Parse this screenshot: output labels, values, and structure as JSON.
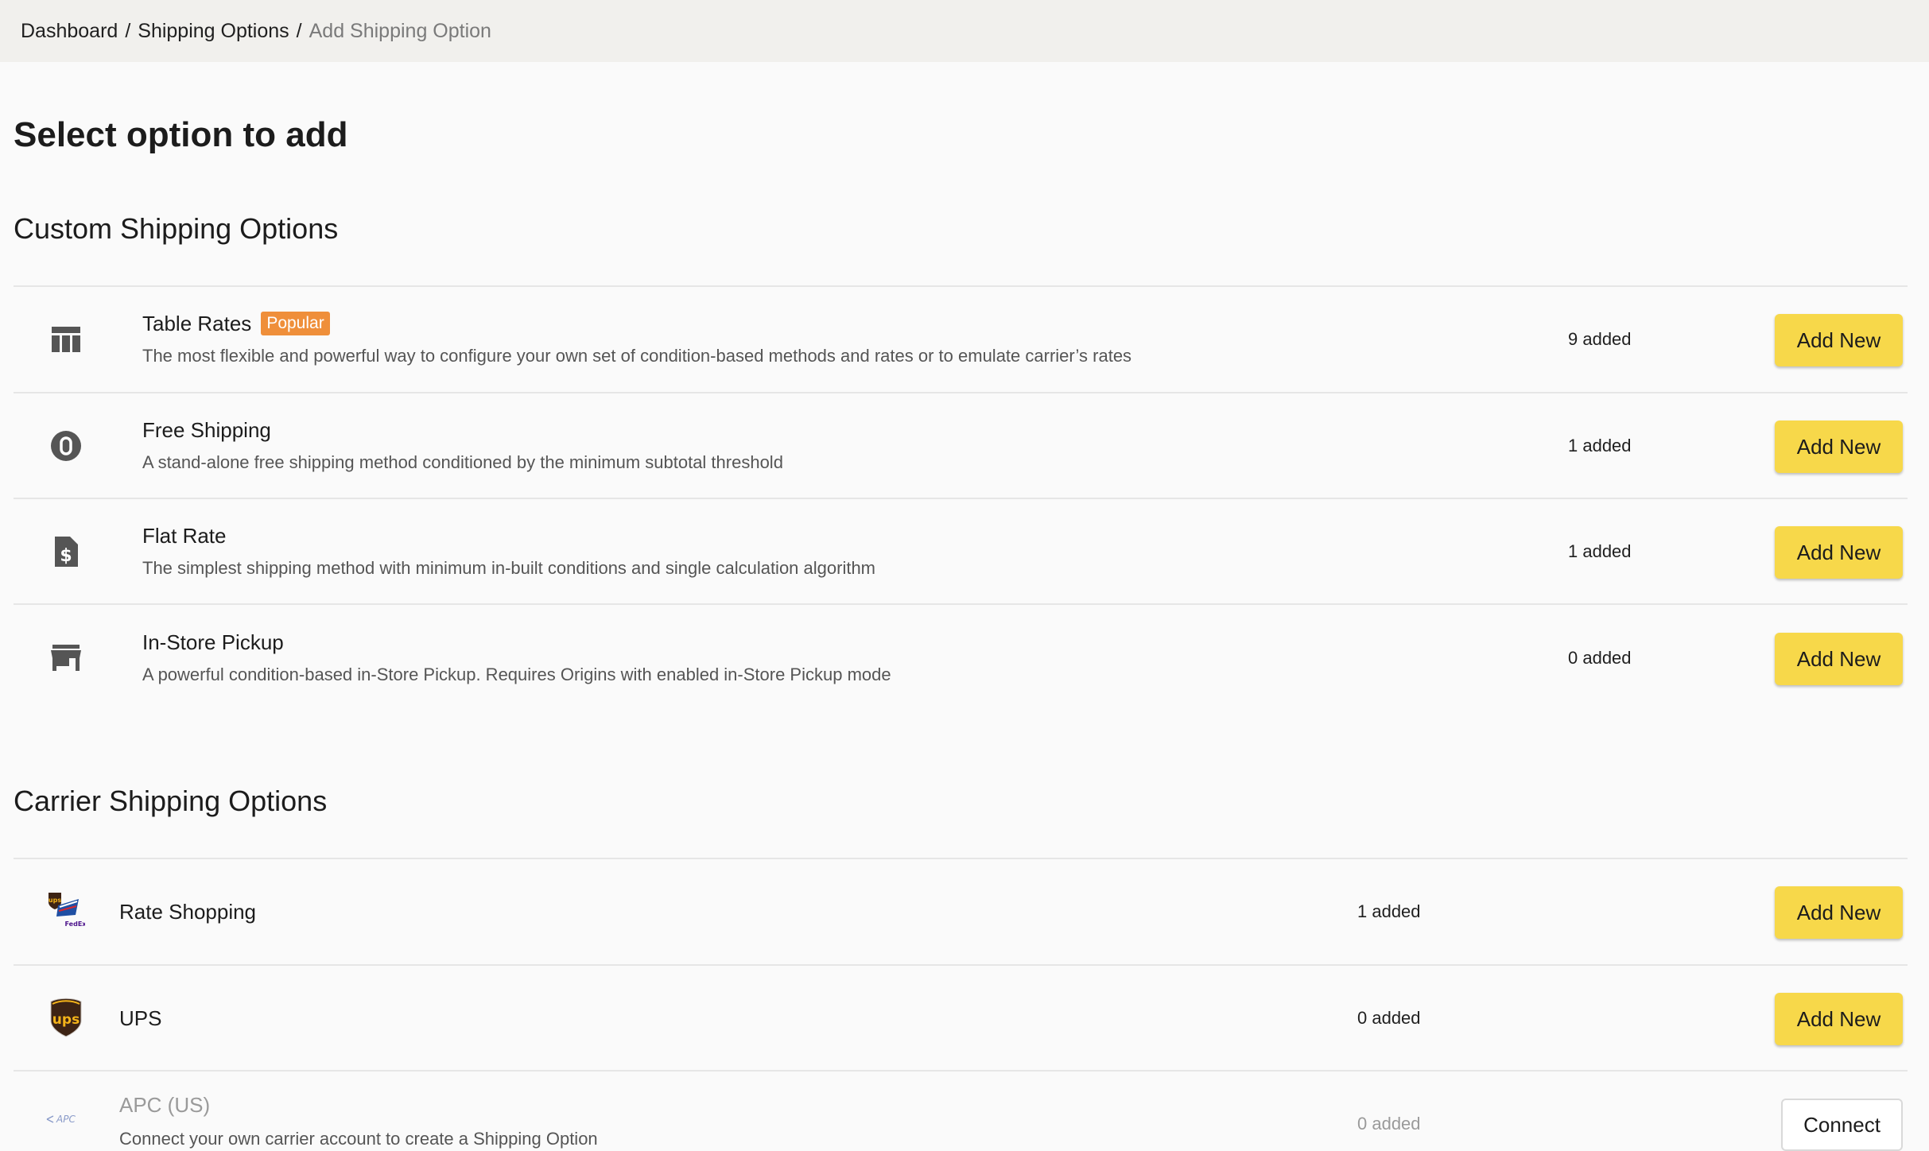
{
  "breadcrumb": {
    "items": [
      "Dashboard",
      "Shipping Options"
    ],
    "separator": "/",
    "current": "Add Shipping Option"
  },
  "page": {
    "title": "Select option to add"
  },
  "custom": {
    "title": "Custom Shipping Options",
    "items": [
      {
        "name": "Table Rates",
        "badge": "Popular",
        "description": "The most flexible and powerful way to configure your own set of condition-based methods and rates or to emulate carrier’s rates",
        "count": "9 added",
        "button": "Add New",
        "icon": "table-icon"
      },
      {
        "name": "Free Shipping",
        "description": "A stand-alone free shipping method conditioned by the minimum subtotal threshold",
        "count": "1 added",
        "button": "Add New",
        "icon": "zero-circle-icon"
      },
      {
        "name": "Flat Rate",
        "description": "The simplest shipping method with minimum in-built conditions and single calculation algorithm",
        "count": "1 added",
        "button": "Add New",
        "icon": "dollar-document-icon"
      },
      {
        "name": "In-Store Pickup",
        "description": "A powerful condition-based in-Store Pickup. Requires Origins with enabled in-Store Pickup mode",
        "count": "0 added",
        "button": "Add New",
        "icon": "store-icon"
      }
    ]
  },
  "carrier": {
    "title": "Carrier Shipping Options",
    "items": [
      {
        "name": "Rate Shopping",
        "count": "1 added",
        "button": "Add New",
        "icon": "rate-shopping-carriers-icon",
        "logo_text": [
          "ups",
          "FedEx"
        ]
      },
      {
        "name": "UPS",
        "count": "0 added",
        "button": "Add New",
        "icon": "ups-logo-icon",
        "logo_text": "ups"
      },
      {
        "name": "APC (US)",
        "description": "Connect your own carrier account to create a Shipping Option",
        "count": "0 added",
        "button": "Connect",
        "icon": "apc-logo-icon",
        "logo_text": "APC"
      }
    ]
  },
  "colors": {
    "accent_button": "#f7d84a",
    "badge": "#ef8f3a",
    "breadcrumb_bg": "#f1f0ed",
    "ups_brown": "#3d2314",
    "ups_gold": "#f4b41a"
  }
}
